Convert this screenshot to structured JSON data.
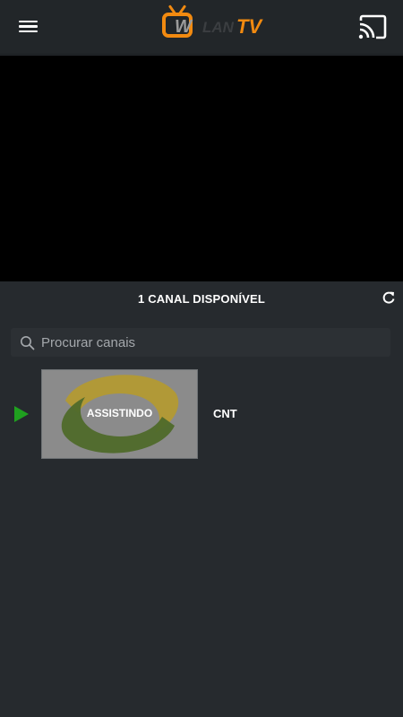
{
  "header": {
    "logo": {
      "text_w": "W",
      "text_lan": "LAN",
      "text_tv": "TV"
    },
    "menu_icon": "hamburger-menu-icon",
    "cast_icon": "cast-icon"
  },
  "player": {
    "state": "empty"
  },
  "channels_header": {
    "count_label": "1 CANAL DISPONÍVEL",
    "refresh_icon": "refresh-icon"
  },
  "search": {
    "placeholder": "Procurar canais",
    "value": "",
    "icon": "search-icon"
  },
  "channels": [
    {
      "name": "CNT",
      "status_label": "ASSISTINDO",
      "playing": true,
      "indicator_icon": "play-icon"
    }
  ],
  "colors": {
    "accent": "#f28a10",
    "play_green": "#1fa01f",
    "background": "#262a2e"
  }
}
